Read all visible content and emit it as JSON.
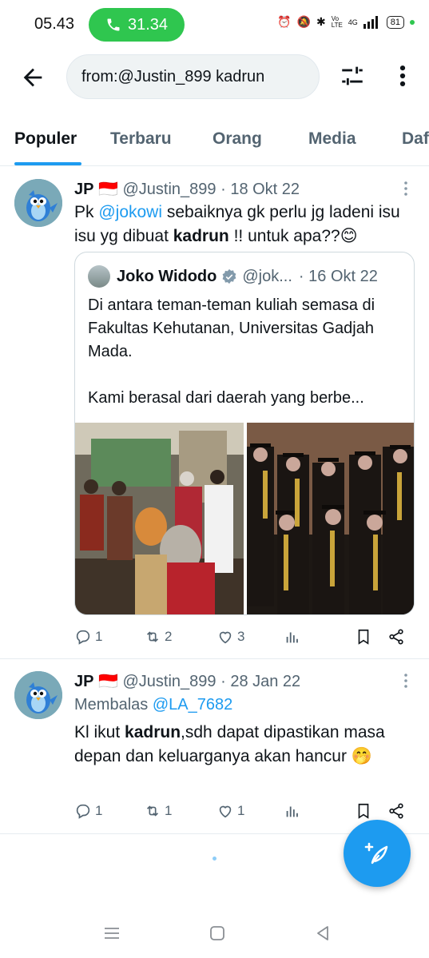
{
  "status_bar": {
    "time": "05.43",
    "call_duration": "31.34",
    "network": "4G",
    "volte": "Vo LTE",
    "battery": "81"
  },
  "search": {
    "query": "from:@Justin_899 kadrun"
  },
  "tabs": [
    {
      "label": "Populer",
      "active": true
    },
    {
      "label": "Terbaru"
    },
    {
      "label": "Orang"
    },
    {
      "label": "Media"
    },
    {
      "label": "Daf"
    }
  ],
  "tweets": [
    {
      "name": "JP",
      "flag": "🇮🇩",
      "handle": "@Justin_899",
      "date": "· 18 Okt 22",
      "text_parts": {
        "p1": "Pk ",
        "mention": "@jokowi",
        "p2": " sebaiknya gk perlu jg ladeni isu isu yg dibuat ",
        "keyword": "kadrun",
        "p3": " !! untuk apa??😊"
      },
      "quote": {
        "name": "Joko Widodo",
        "handle": "@jok...",
        "date": "· 16 Okt 22",
        "text": "Di antara teman-teman kuliah semasa di Fakultas Kehutanan, Universitas Gadjah Mada.",
        "text2": "Kami berasal dari daerah yang berbe..."
      },
      "replies": "1",
      "retweets": "2",
      "likes": "3"
    },
    {
      "name": "JP",
      "flag": "🇮🇩",
      "handle": "@Justin_899",
      "date": "· 28 Jan 22",
      "reply_prefix": "Membalas ",
      "reply_to": "@LA_7682",
      "text_parts": {
        "p1": "Kl ikut ",
        "keyword": "kadrun",
        "p2": ",sdh dapat dipastikan masa depan dan keluarganya akan hancur 🤭"
      },
      "replies": "1",
      "retweets": "1",
      "likes": "1"
    }
  ],
  "colors": {
    "accent": "#1d9bf0",
    "call_pill": "#2fc64f",
    "muted_text": "#536471"
  }
}
